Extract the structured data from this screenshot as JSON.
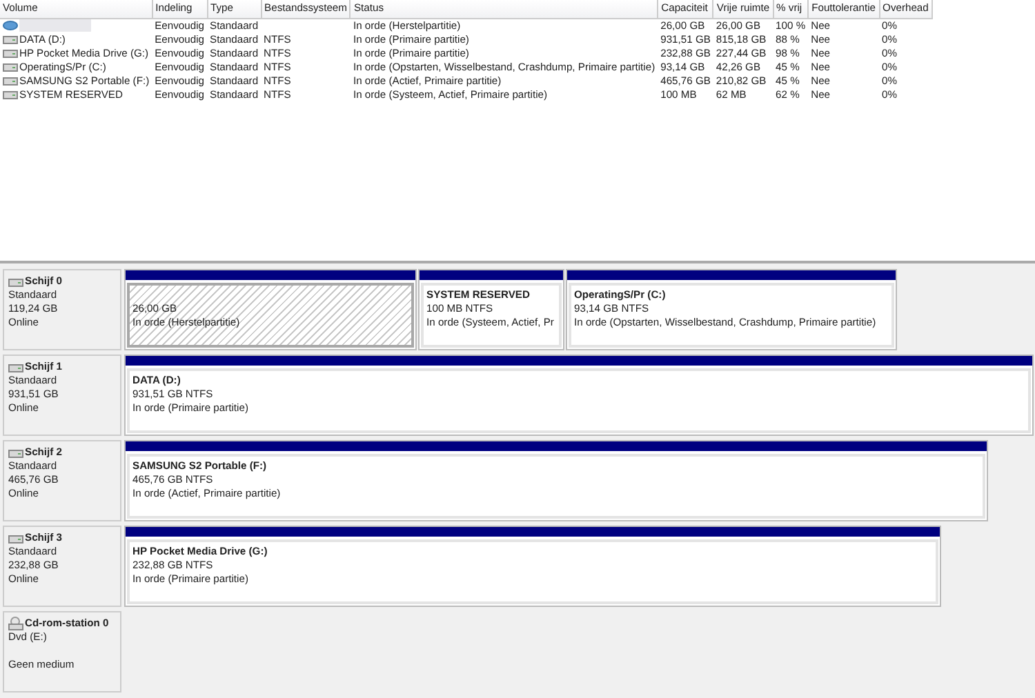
{
  "table": {
    "columns": [
      "Volume",
      "Indeling",
      "Type",
      "Bestandssysteem",
      "Status",
      "Capaciteit",
      "Vrije ruimte",
      "% vrij",
      "Fouttolerantie",
      "Overhead"
    ],
    "rows": [
      {
        "kind": "recovery",
        "selected": true,
        "cells": [
          "",
          "Eenvoudig",
          "Standaard",
          "",
          "In orde (Herstelpartitie)",
          "26,00 GB",
          "26,00 GB",
          "100 %",
          "Nee",
          "0%"
        ]
      },
      {
        "kind": "drive",
        "selected": false,
        "cells": [
          "DATA (D:)",
          "Eenvoudig",
          "Standaard",
          "NTFS",
          "In orde (Primaire partitie)",
          "931,51 GB",
          "815,18 GB",
          "88 %",
          "Nee",
          "0%"
        ]
      },
      {
        "kind": "drive",
        "selected": false,
        "cells": [
          "HP Pocket Media Drive (G:)",
          "Eenvoudig",
          "Standaard",
          "NTFS",
          "In orde (Primaire partitie)",
          "232,88 GB",
          "227,44 GB",
          "98 %",
          "Nee",
          "0%"
        ]
      },
      {
        "kind": "drive",
        "selected": false,
        "cells": [
          "OperatingS/Pr (C:)",
          "Eenvoudig",
          "Standaard",
          "NTFS",
          "In orde (Opstarten, Wisselbestand, Crashdump, Primaire partitie)",
          "93,14 GB",
          "42,26 GB",
          "45 %",
          "Nee",
          "0%"
        ]
      },
      {
        "kind": "drive",
        "selected": false,
        "cells": [
          "SAMSUNG S2 Portable (F:)",
          "Eenvoudig",
          "Standaard",
          "NTFS",
          "In orde (Actief, Primaire partitie)",
          "465,76 GB",
          "210,82 GB",
          "45 %",
          "Nee",
          "0%"
        ]
      },
      {
        "kind": "drive",
        "selected": false,
        "cells": [
          "SYSTEM RESERVED",
          "Eenvoudig",
          "Standaard",
          "NTFS",
          "In orde (Systeem, Actief, Primaire partitie)",
          "100 MB",
          "62 MB",
          "62 %",
          "Nee",
          "0%"
        ]
      }
    ]
  },
  "disks": [
    {
      "kind": "disk",
      "name": "Schijf 0",
      "lines": [
        "Standaard",
        "119,24 GB",
        "Online"
      ],
      "partitions": [
        {
          "selected": true,
          "lines": [
            "26,00 GB",
            "In orde (Herstelpartitie)"
          ]
        },
        {
          "selected": false,
          "title": "SYSTEM RESERVED",
          "lines": [
            "100 MB NTFS",
            "In orde (Systeem, Actief, Pr"
          ]
        },
        {
          "selected": false,
          "title": "OperatingS/Pr  (C:)",
          "lines": [
            "93,14 GB NTFS",
            "In orde (Opstarten, Wisselbestand, Crashdump, Primaire partitie)"
          ]
        }
      ]
    },
    {
      "kind": "disk",
      "name": "Schijf 1",
      "lines": [
        "Standaard",
        "931,51 GB",
        "Online"
      ],
      "partitions": [
        {
          "selected": false,
          "title": "DATA  (D:)",
          "lines": [
            "931,51 GB NTFS",
            "In orde (Primaire partitie)"
          ]
        }
      ]
    },
    {
      "kind": "disk",
      "name": "Schijf 2",
      "lines": [
        "Standaard",
        "465,76 GB",
        "Online"
      ],
      "partitions": [
        {
          "selected": false,
          "title": "SAMSUNG S2 Portable  (F:)",
          "lines": [
            "465,76 GB NTFS",
            "In orde (Actief, Primaire partitie)"
          ]
        }
      ]
    },
    {
      "kind": "disk",
      "name": "Schijf 3",
      "lines": [
        "Standaard",
        "232,88 GB",
        "Online"
      ],
      "partitions": [
        {
          "selected": false,
          "title": "HP Pocket Media Drive  (G:)",
          "lines": [
            "232,88 GB NTFS",
            "In orde (Primaire partitie)"
          ]
        }
      ]
    },
    {
      "kind": "cdrom",
      "name": "Cd-rom-station 0",
      "lines": [
        "Dvd (E:)",
        "Geen medium"
      ]
    }
  ]
}
